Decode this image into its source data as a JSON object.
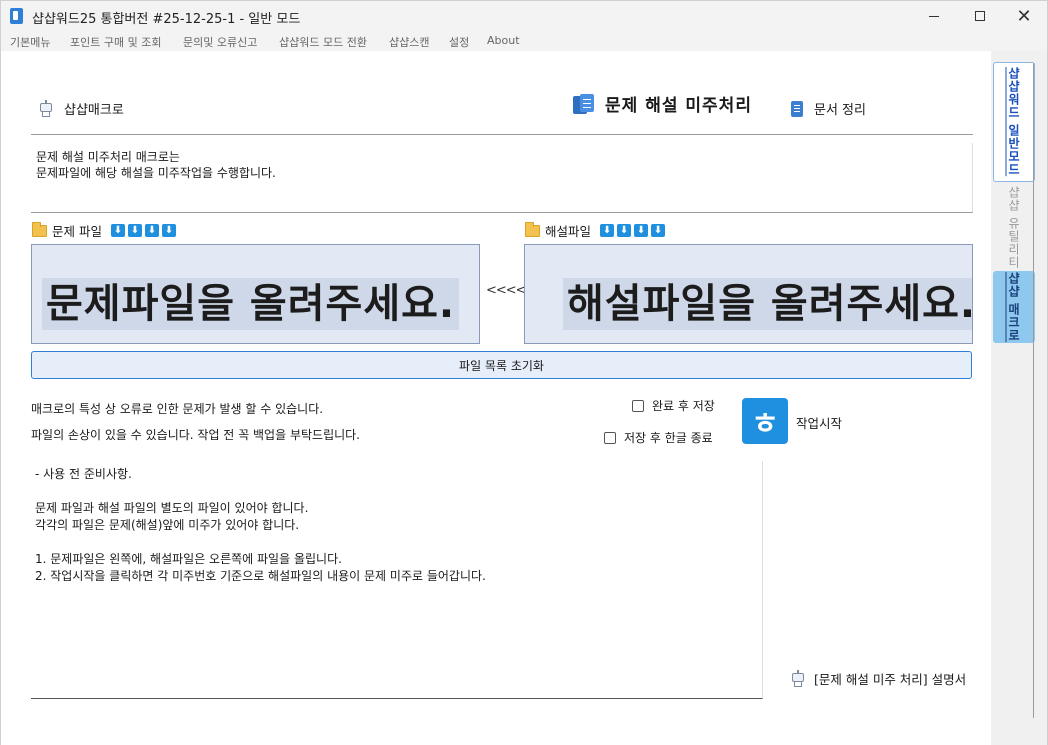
{
  "window": {
    "title": "샵샵워드25 통합버전 #25-12-25-1 - 일반 모드",
    "minimize_label": "minimize",
    "maximize_label": "maximize",
    "close_label": "✕"
  },
  "menu": {
    "items": [
      "기본메뉴",
      "포인트 구매 및 조회",
      "문의및 오류신고",
      "샵샵워드 모드 전환",
      "샵샵스캔",
      "설정",
      "About"
    ]
  },
  "header": {
    "left_label": "샵샵매크로",
    "center_title": "문제 해설 미주처리",
    "right_label": "문서 정리"
  },
  "description": {
    "lines": [
      "문제 해설 미주처리 매크로는",
      "문제파일에 해당 해설을 미주작업을 수행합니다."
    ]
  },
  "problem_file": {
    "label": "문제 파일",
    "placeholder": "문제파일을 올려주세요."
  },
  "solution_file": {
    "label": "해설파일",
    "placeholder": "해설파일을 올려주세요."
  },
  "arrows": "<<<<",
  "reset_button": "파일 목록 초기화",
  "warnings": [
    "매크로의 특성 상 오류로 인한 문제가 발생 할 수 있습니다.",
    "파일의 손상이 있을 수 있습니다. 작업 전 꼭 백업을 부탁드립니다."
  ],
  "options": {
    "save_after": "완료 후 저장",
    "close_after": "저장 후 한글 종료"
  },
  "start": {
    "icon_glyph": "ㅎ",
    "label": "작업시작"
  },
  "notes": {
    "lines": [
      "- 사용 전 준비사항.",
      "",
      "문제 파일과 해설 파일의 별도의 파일이 있어야 합니다.",
      "각각의 파일은 문제(해설)앞에 미주가 있어야 합니다.",
      "",
      "1. 문제파일은 왼쪽에, 해설파일은 오른쪽에 파일을 올립니다.",
      "2. 작업시작을 클릭하면 각 미주번호 기준으로 해설파일의 내용이 문제 미주로 들어갑니다."
    ]
  },
  "manual_link": "[문제 해설 미주 처리] 설명서",
  "side_tabs": [
    "샵샵워드 일반모드",
    "샵샵 유틸리티",
    "샵샵 매크로"
  ],
  "colors": {
    "accent": "#1f8fe0",
    "drop_zone_bg": "#e3e9f4",
    "drop_text_bg": "#cfd8e8",
    "active_tab_bg": "#8ec8ee"
  },
  "icons": {
    "download": "⬇"
  }
}
